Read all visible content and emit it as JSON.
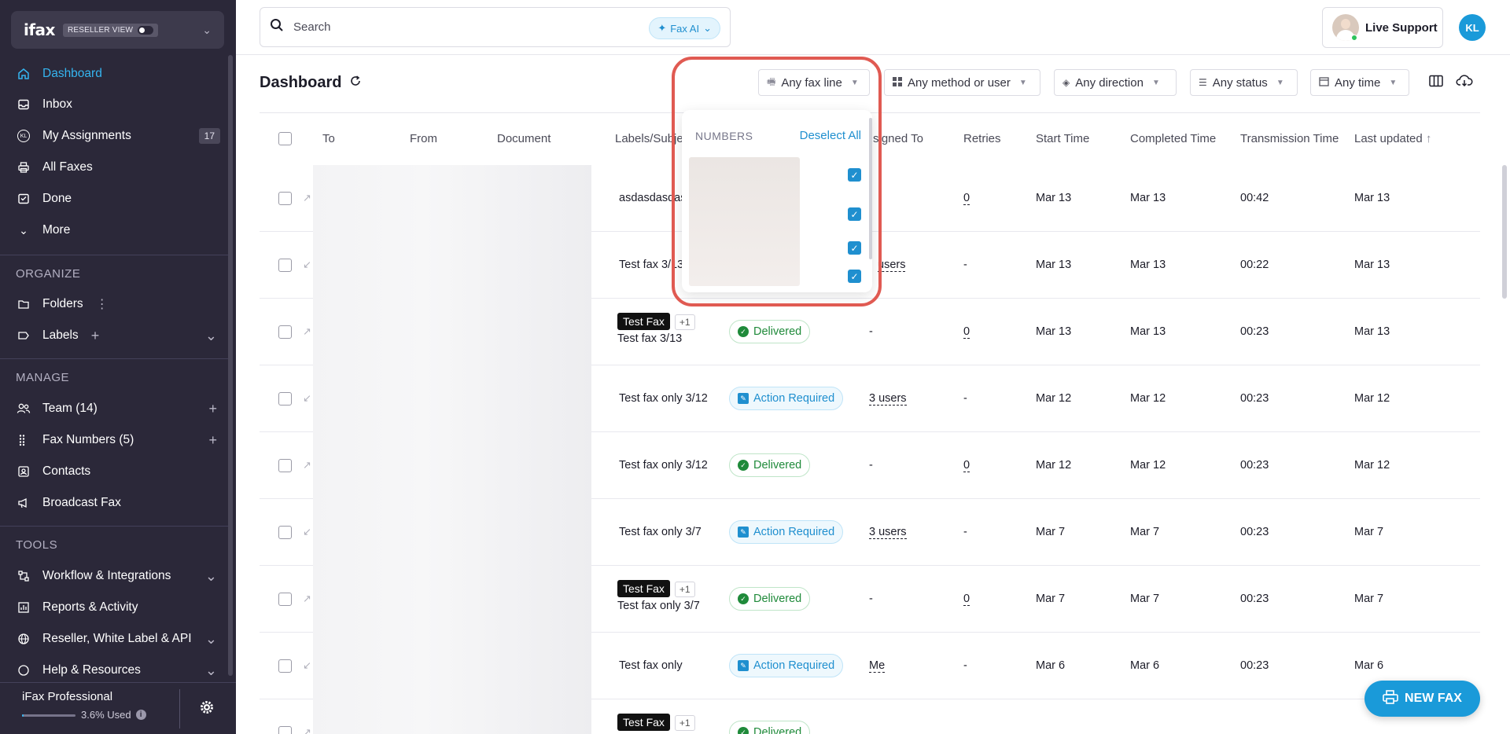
{
  "brand": {
    "logo": "ifax",
    "view_label": "RESELLER VIEW"
  },
  "sidebar": {
    "nav": [
      {
        "label": "Dashboard",
        "icon": "home-icon"
      },
      {
        "label": "Inbox",
        "icon": "inbox-icon"
      },
      {
        "label": "My Assignments",
        "icon": "kl-initials-icon",
        "icon_text": "KL",
        "count": "17"
      },
      {
        "label": "All Faxes",
        "icon": "printer-icon"
      },
      {
        "label": "Done",
        "icon": "done-inbox-icon"
      },
      {
        "label": "More",
        "icon": "chevron-down-icon"
      }
    ],
    "organize_title": "ORGANIZE",
    "organize": [
      {
        "label": "Folders"
      },
      {
        "label": "Labels"
      }
    ],
    "manage_title": "MANAGE",
    "manage": [
      {
        "label": "Team (14)"
      },
      {
        "label": "Fax Numbers (5)"
      },
      {
        "label": "Contacts"
      },
      {
        "label": "Broadcast Fax"
      }
    ],
    "tools_title": "TOOLS",
    "tools": [
      {
        "label": "Workflow & Integrations"
      },
      {
        "label": "Reports & Activity"
      },
      {
        "label": "Reseller, White Label & API"
      },
      {
        "label": "Help & Resources"
      }
    ],
    "footer": {
      "plan": "iFax Professional",
      "used": "3.6% Used",
      "used_fraction": 0.036
    }
  },
  "topbar": {
    "search_placeholder": "Search",
    "faxai_label": "Fax AI",
    "live_support": "Live Support",
    "user_initials": "KL"
  },
  "header": {
    "title": "Dashboard",
    "filters": {
      "fax_line": "Any fax line",
      "method": "Any method or user",
      "direction": "Any direction",
      "status": "Any status",
      "time": "Any time"
    }
  },
  "table": {
    "columns": {
      "to": "To",
      "from": "From",
      "document": "Document",
      "labels": "Labels/Subje",
      "assigned": "signed To",
      "retries": "Retries",
      "start": "Start Time",
      "completed": "Completed Time",
      "transmission": "Transmission Time",
      "updated": "Last updated"
    },
    "rows": [
      {
        "dir": "out",
        "tag": "",
        "subject": "asdasdasdas",
        "status": "",
        "assigned": "",
        "retries": "0",
        "start": "Mar 13",
        "completed": "Mar 13",
        "transmission": "00:42",
        "updated": "Mar 13"
      },
      {
        "dir": "in",
        "tag": "",
        "subject": "Test fax 3/13",
        "status": "",
        "assigned": "users",
        "retries": "-",
        "start": "Mar 13",
        "completed": "Mar 13",
        "transmission": "00:22",
        "updated": "Mar 13"
      },
      {
        "dir": "out",
        "tag": "Test Fax",
        "plus": "+1",
        "subject": "Test fax 3/13",
        "status": "Delivered",
        "assigned": "-",
        "retries": "0",
        "start": "Mar 13",
        "completed": "Mar 13",
        "transmission": "00:23",
        "updated": "Mar 13"
      },
      {
        "dir": "in",
        "tag": "",
        "subject": "Test fax only 3/12",
        "status": "Action Required",
        "assigned": "3 users",
        "retries": "-",
        "start": "Mar 12",
        "completed": "Mar 12",
        "transmission": "00:23",
        "updated": "Mar 12"
      },
      {
        "dir": "out",
        "tag": "",
        "subject": "Test fax only 3/12",
        "status": "Delivered",
        "assigned": "-",
        "retries": "0",
        "start": "Mar 12",
        "completed": "Mar 12",
        "transmission": "00:23",
        "updated": "Mar 12"
      },
      {
        "dir": "in",
        "tag": "",
        "subject": "Test fax only 3/7",
        "status": "Action Required",
        "assigned": "3 users",
        "retries": "-",
        "start": "Mar 7",
        "completed": "Mar 7",
        "transmission": "00:23",
        "updated": "Mar 7"
      },
      {
        "dir": "out",
        "tag": "Test Fax",
        "plus": "+1",
        "subject": "Test fax only 3/7",
        "status": "Delivered",
        "assigned": "-",
        "retries": "0",
        "start": "Mar 7",
        "completed": "Mar 7",
        "transmission": "00:23",
        "updated": "Mar 7"
      },
      {
        "dir": "in",
        "tag": "",
        "subject": "Test fax only",
        "status": "Action Required",
        "assigned": "Me",
        "retries": "-",
        "start": "Mar 6",
        "completed": "Mar 6",
        "transmission": "00:23",
        "updated": "Mar 6"
      },
      {
        "dir": "out",
        "tag": "Test Fax",
        "plus": "+1",
        "subject": "",
        "status": "Delivered",
        "assigned": "",
        "retries": "",
        "start": "",
        "completed": "",
        "transmission": "",
        "updated": ""
      }
    ]
  },
  "dropdown": {
    "title": "NUMBERS",
    "action": "Deselect All"
  },
  "new_fax": {
    "label": "NEW FAX"
  },
  "colors": {
    "accent": "#1a9ad9",
    "sidebar_bg": "#2b2839",
    "delivered": "#1f8a3a",
    "highlight": "#e05a52"
  }
}
